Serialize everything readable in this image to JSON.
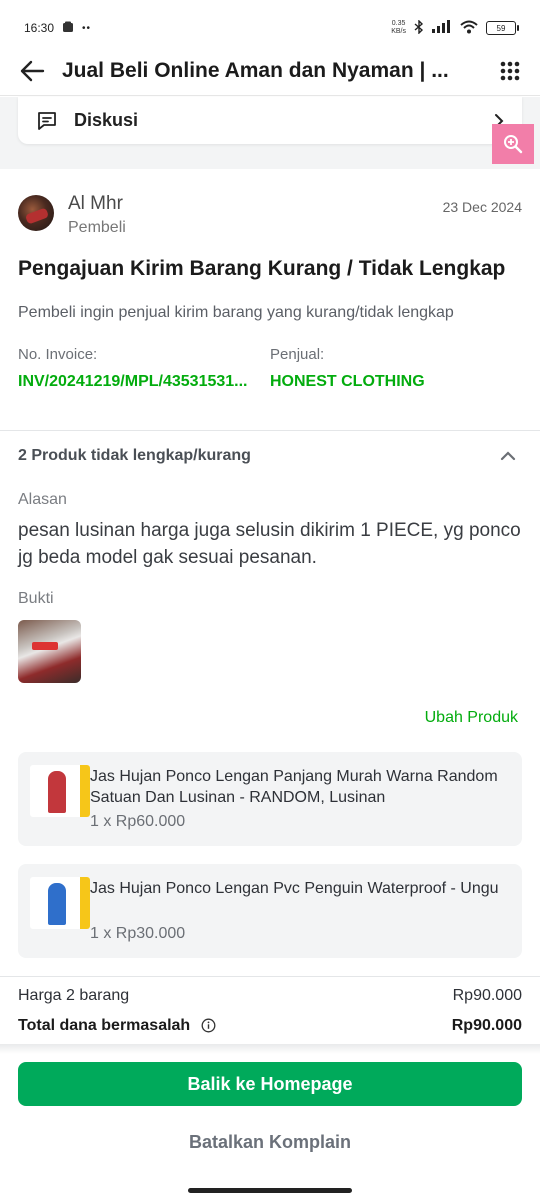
{
  "status_bar": {
    "time": "16:30",
    "dots": "••",
    "net_speed_top": "0.35",
    "net_speed_bottom": "KB/s",
    "battery": "59"
  },
  "header": {
    "title": "Jual Beli Online Aman dan Nyaman | ..."
  },
  "discussion": {
    "label": "Diskusi"
  },
  "complaint": {
    "user_name": "Al Mhr",
    "user_role": "Pembeli",
    "date": "23 Dec 2024",
    "title": "Pengajuan Kirim Barang Kurang / Tidak Lengkap",
    "description": "Pembeli ingin penjual kirim barang yang kurang/tidak lengkap",
    "invoice_label": "No. Invoice:",
    "invoice_value": "INV/20241219/MPL/43531531...",
    "seller_label": "Penjual:",
    "seller_value": "HONEST CLOTHING"
  },
  "products_section": {
    "heading": "2 Produk tidak lengkap/kurang",
    "reason_label": "Alasan",
    "reason_text": "pesan lusinan harga juga selusin dikirim 1 PIECE, yg ponco jg beda model gak sesuai pesanan.",
    "proof_label": "Bukti",
    "change_product": "Ubah Produk",
    "items": [
      {
        "name": "Jas Hujan Ponco Lengan Panjang Murah Warna Random Satuan Dan Lusinan - RANDOM, Lusinan",
        "qty_price": "1 x Rp60.000"
      },
      {
        "name": "Jas Hujan Ponco Lengan Pvc Penguin Waterproof - Ungu",
        "qty_price": "1 x Rp30.000"
      }
    ]
  },
  "summary": {
    "items_label": "Harga 2 barang",
    "items_value": "Rp90.000",
    "total_label": "Total dana bermasalah",
    "total_value": "Rp90.000"
  },
  "actions": {
    "primary": "Balik ke Homepage",
    "secondary": "Batalkan Komplain"
  },
  "colors": {
    "brand_green": "#03ac0e",
    "button_green": "#00aa5b",
    "zoom_fab_pink": "#f27ea9"
  }
}
